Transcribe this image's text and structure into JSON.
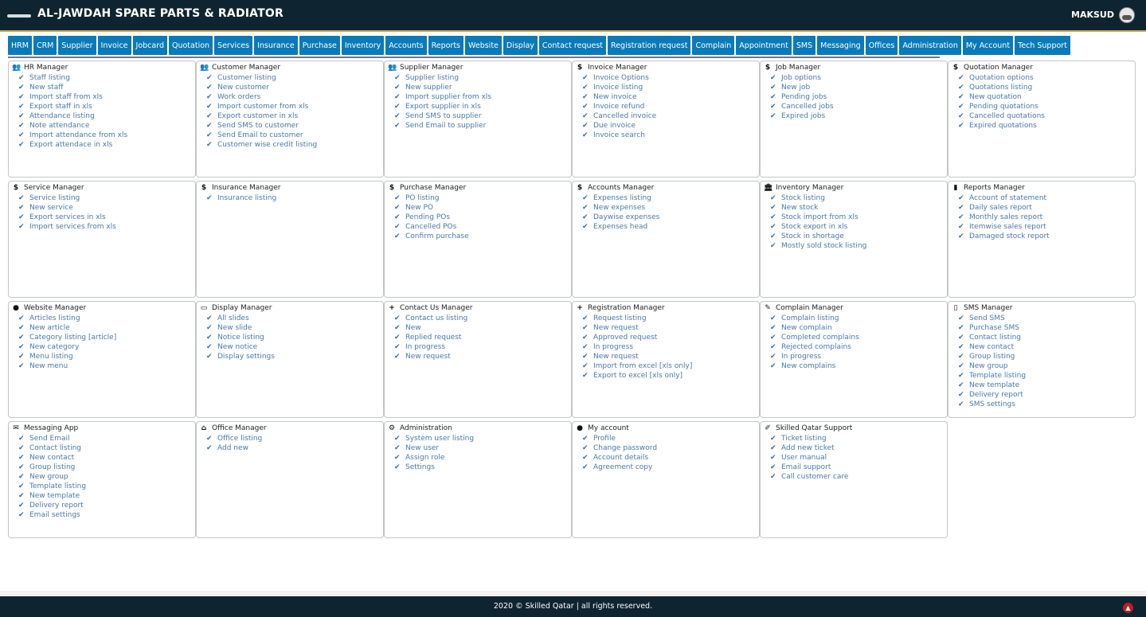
{
  "header": {
    "title": "AL-JAWDAH SPARE PARTS & RADIATOR",
    "user": "MAKSUD"
  },
  "nav": [
    "HRM",
    "CRM",
    "Supplier",
    "Invoice",
    "Jobcard",
    "Quotation",
    "Services",
    "Insurance",
    "Purchase",
    "Inventory",
    "Accounts",
    "Reports",
    "Website",
    "Display",
    "Contact request",
    "Registration request",
    "Complain",
    "Appointment",
    "SMS",
    "Messaging",
    "Offices",
    "Administration",
    "My Account",
    "Tech Support"
  ],
  "cards": [
    {
      "title": "HR Manager",
      "icon": "users-icon",
      "glyph": "👥",
      "items": [
        "Staff listing",
        "New staff",
        "Import staff from xls",
        "Export staff in xls",
        "Attendance listing",
        "Note attendance",
        "Import attendance from xls",
        "Export attendace in xls"
      ]
    },
    {
      "title": "Customer Manager",
      "icon": "users-icon",
      "glyph": "👥",
      "items": [
        "Customer listing",
        "New customer",
        "Work orders",
        "Import customer from xls",
        "Export customer in xls",
        "Send SMS to customer",
        "Send Email to customer",
        "Customer wise credit listing"
      ]
    },
    {
      "title": "Supplier Manager",
      "icon": "users-icon",
      "glyph": "👥",
      "items": [
        "Supplier listing",
        "New supplier",
        "Import supplier from xls",
        "Export supplier in xls",
        "Send SMS to supplier",
        "Send Email to supplier"
      ]
    },
    {
      "title": "Invoice Manager",
      "icon": "dollar-icon",
      "glyph": "$",
      "items": [
        "Invoice Options",
        "Invoice listing",
        "New invoice",
        "Invoice refund",
        "Cancelled invoice",
        "Due invoice",
        "Invoice search"
      ]
    },
    {
      "title": "Job Manager",
      "icon": "dollar-icon",
      "glyph": "$",
      "items": [
        "Job options",
        "New job",
        "Pending jobs",
        "Cancelled jobs",
        "Expired jobs"
      ]
    },
    {
      "title": "Quotation Manager",
      "icon": "dollar-icon",
      "glyph": "$",
      "items": [
        "Quotation options",
        "Quotations listing",
        "New quotation",
        "Pending quotations",
        "Cancelled quotations",
        "Expired quotations"
      ]
    },
    {
      "title": "Service Manager",
      "icon": "dollar-icon",
      "glyph": "$",
      "items": [
        "Service listing",
        "New service",
        "Export services in xls",
        "Import services from xls"
      ]
    },
    {
      "title": "Insurance Manager",
      "icon": "dollar-icon",
      "glyph": "$",
      "items": [
        "Insurance listing"
      ]
    },
    {
      "title": "Purchase Manager",
      "icon": "dollar-icon",
      "glyph": "$",
      "items": [
        "PO listing",
        "New PO",
        "Pending POs",
        "Cancelled POs",
        "Confirm purchase"
      ]
    },
    {
      "title": "Accounts Manager",
      "icon": "dollar-icon",
      "glyph": "$",
      "items": [
        "Expenses listing",
        "New expenses",
        "Daywise expenses",
        "Expenses head"
      ]
    },
    {
      "title": "Inventory Manager",
      "icon": "bank-icon",
      "glyph": "🏛",
      "items": [
        "Stock listing",
        "New stock",
        "Stock import from xls",
        "Stock export in xls",
        "Stock in shortage",
        "Mostly sold stock listing"
      ]
    },
    {
      "title": "Reports Manager",
      "icon": "file-icon",
      "glyph": "▮",
      "items": [
        "Account of statement",
        "Daily sales report",
        "Monthly sales report",
        "Itemwise sales report",
        "Damaged stock report"
      ]
    },
    {
      "title": "Website Manager",
      "icon": "globe-icon",
      "glyph": "●",
      "items": [
        "Articles listing",
        "New article",
        "Category listing [article]",
        "New category",
        "Menu listing",
        "New menu"
      ]
    },
    {
      "title": "Display Manager",
      "icon": "monitor-icon",
      "glyph": "▭",
      "items": [
        "All slides",
        "New slide",
        "Notice listing",
        "New notice",
        "Display settings"
      ]
    },
    {
      "title": "Contact Us Manager",
      "icon": "plus-icon",
      "glyph": "+",
      "items": [
        "Contact us listing",
        "New",
        "Replied request",
        "In progress",
        "New request"
      ]
    },
    {
      "title": "Registration Manager",
      "icon": "plus-icon",
      "glyph": "+",
      "items": [
        "Request listing",
        "New request",
        "Approved request",
        "In progress",
        "New request",
        "Import from excel [xls only]",
        "Export to excel [xls only]"
      ]
    },
    {
      "title": "Complain Manager",
      "icon": "edit-icon",
      "glyph": "✎",
      "items": [
        "Complain listing",
        "New complain",
        "Completed complains",
        "Rejected complains",
        "In progress",
        "New complains"
      ]
    },
    {
      "title": "SMS Manager",
      "icon": "mobile-icon",
      "glyph": "▯",
      "items": [
        "Send SMS",
        "Purchase SMS",
        "Contact listing",
        "New contact",
        "Group listing",
        "New group",
        "Template listing",
        "New template",
        "Delivery report",
        "SMS settings"
      ]
    },
    {
      "title": "Messaging App",
      "icon": "envelope-icon",
      "glyph": "✉",
      "items": [
        "Send Email",
        "Contact listing",
        "New contact",
        "Group listing",
        "New group",
        "Template listing",
        "New template",
        "Delivery report",
        "Email settings"
      ]
    },
    {
      "title": "Office Manager",
      "icon": "home-icon",
      "glyph": "⌂",
      "items": [
        "Office listing",
        "Add new"
      ]
    },
    {
      "title": "Administration",
      "icon": "gear-icon",
      "glyph": "⚙",
      "items": [
        "System user listing",
        "New user",
        "Assign role",
        "Settings"
      ]
    },
    {
      "title": "My account",
      "icon": "user-icon",
      "glyph": "●",
      "items": [
        "Profile",
        "Change password",
        "Account details",
        "Agreement copy"
      ]
    },
    {
      "title": "Skilled Qatar Support",
      "icon": "wrench-icon",
      "glyph": "✐",
      "items": [
        "Ticket listing",
        "Add new ticket",
        "User manual",
        "Email support",
        "Call customer care"
      ]
    }
  ],
  "footer": {
    "text": "2020 © Skilled Qatar | all rights reserved."
  },
  "colors": {
    "topbar": "#0e2430",
    "nav": "#0a7ab8",
    "link": "#4a79a8",
    "accent": "#c9a85a"
  }
}
